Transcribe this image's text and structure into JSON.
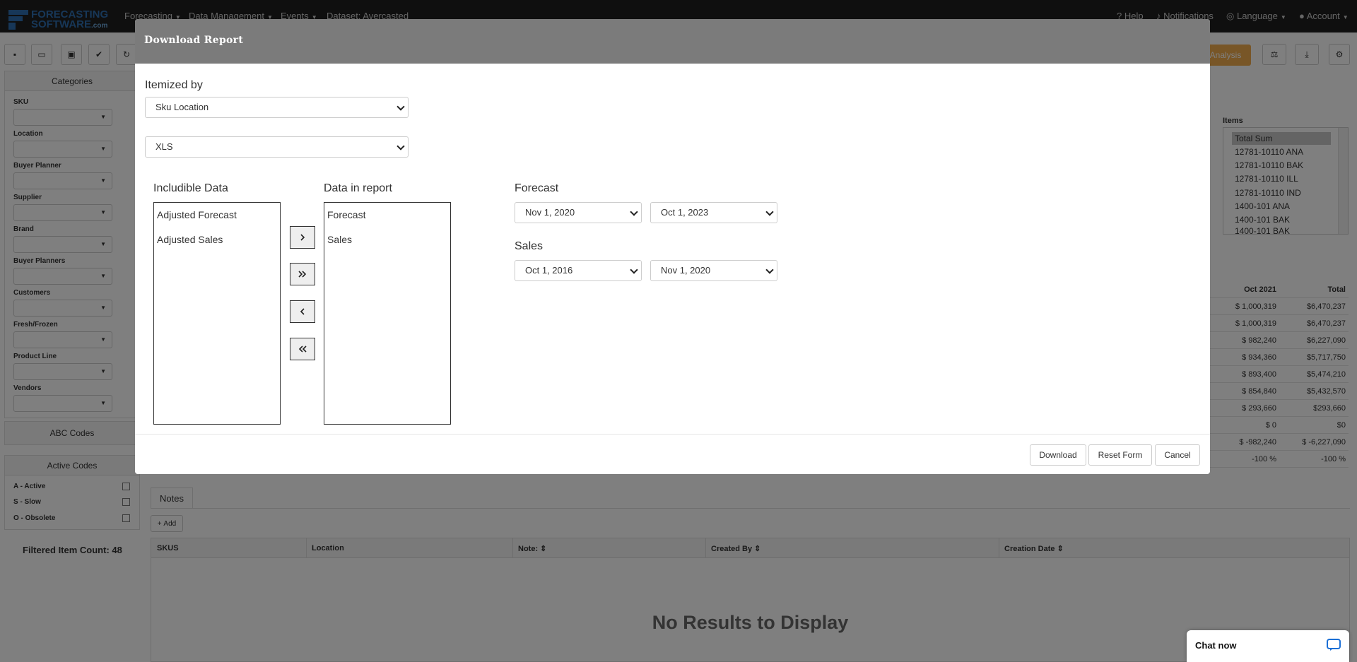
{
  "app": {
    "logo_line1": "FORECASTING",
    "logo_line2": "SOFTWARE",
    "logo_suffix": ".com",
    "nav": {
      "forecasting": "Forecasting",
      "data_management": "Data Management",
      "events": "Events",
      "dataset": "Dataset: Avercasted",
      "help": "Help",
      "notifications": "Notifications",
      "language": "Language",
      "account": "Account"
    },
    "toolbar": {
      "analysis": "Analysis"
    }
  },
  "sidebar": {
    "categories_title": "Categories",
    "filters": [
      "SKU",
      "Location",
      "Buyer Planner",
      "Supplier",
      "Brand",
      "Buyer Planners",
      "Customers",
      "Fresh/Frozen",
      "Product Line",
      "Vendors"
    ],
    "abc_codes": "ABC Codes",
    "active_codes": "Active Codes",
    "codes": [
      "A - Active",
      "S - Slow",
      "O - Obsolete"
    ],
    "filtered_count": "Filtered Item Count: 48"
  },
  "items": {
    "label": "Items",
    "list": [
      "Total Sum",
      "12781-10110 ANA",
      "12781-10110 BAK",
      "12781-10110 ILL",
      "12781-10110 IND",
      "1400-101 ANA",
      "1400-101 BAK",
      "1400-101 BAK"
    ]
  },
  "summary": {
    "headers": [
      "Oct 2021",
      "Total"
    ],
    "rows": [
      [
        "$ 1,000,319",
        "$6,470,237"
      ],
      [
        "$ 1,000,319",
        "$6,470,237"
      ],
      [
        "$ 982,240",
        "$6,227,090"
      ],
      [
        "$ 934,360",
        "$5,717,750"
      ],
      [
        "$ 893,400",
        "$5,474,210"
      ],
      [
        "$ 854,840",
        "$5,432,570"
      ],
      [
        "$ 293,660",
        "$293,660"
      ],
      [
        "$ 0",
        "$0"
      ],
      [
        "$ -982,240",
        "$ -6,227,090"
      ],
      [
        "-100 %",
        "-100 %"
      ]
    ]
  },
  "notes": {
    "tab": "Notes",
    "add": "Add",
    "columns": [
      "SKUS",
      "Location",
      "Note:",
      "Created By",
      "Creation Date"
    ],
    "empty": "No Results to Display"
  },
  "modal": {
    "title": "Download Report",
    "itemized_label": "Itemized by",
    "itemized_value": "Sku Location",
    "format_value": "XLS",
    "includible_label": "Includible Data",
    "includible_items": [
      "Adjusted Forecast",
      "Adjusted Sales"
    ],
    "report_label": "Data in report",
    "report_items": [
      "Forecast",
      "Sales"
    ],
    "forecast_label": "Forecast",
    "forecast_from": "Nov 1, 2020",
    "forecast_to": "Oct 1, 2023",
    "sales_label": "Sales",
    "sales_from": "Oct 1, 2016",
    "sales_to": "Nov 1, 2020",
    "download": "Download",
    "reset": "Reset Form",
    "cancel": "Cancel"
  },
  "chat": {
    "label": "Chat now"
  }
}
